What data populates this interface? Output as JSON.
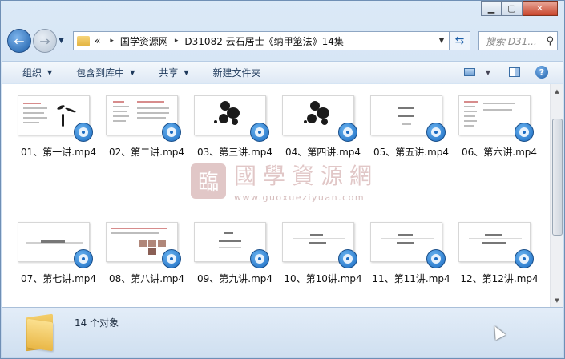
{
  "window": {
    "minimize_icon": "minimize-icon",
    "maximize_icon": "maximize-icon",
    "close_icon": "close-icon"
  },
  "nav": {
    "back_icon": "back-arrow-icon",
    "forward_icon": "forward-arrow-icon",
    "history_icon": "chevron-down-icon"
  },
  "address": {
    "overflow": "«",
    "crumbs": [
      "国学资源网",
      "D31082 云石居士《纳甲筮法》14集"
    ],
    "separator": "▸"
  },
  "search": {
    "placeholder": "搜索 D31...",
    "icon": "search-icon"
  },
  "toolbar": {
    "organize": "组织",
    "include_library": "包含到库中",
    "share": "共享",
    "new_folder": "新建文件夹"
  },
  "watermark": {
    "logo_char": "臨",
    "title": "國學資源網",
    "url": "www.guoxueziyuan.com"
  },
  "files": [
    {
      "name": "01、第一讲.mp4",
      "style": "ink-plant"
    },
    {
      "name": "02、第二讲.mp4",
      "style": "text-doc"
    },
    {
      "name": "03、第三讲.mp4",
      "style": "ink-blot"
    },
    {
      "name": "04、第四讲.mp4",
      "style": "ink-blot"
    },
    {
      "name": "05、第五讲.mp4",
      "style": "title-card"
    },
    {
      "name": "06、第六讲.mp4",
      "style": "text-doc"
    },
    {
      "name": "07、第七讲.mp4",
      "style": "title-line"
    },
    {
      "name": "08、第八讲.mp4",
      "style": "boxes"
    },
    {
      "name": "09、第九讲.mp4",
      "style": "title-card"
    },
    {
      "name": "10、第10讲.mp4",
      "style": "title-card"
    },
    {
      "name": "11、第11讲.mp4",
      "style": "title-card"
    },
    {
      "name": "12、第12讲.mp4",
      "style": "title-card"
    }
  ],
  "status": {
    "count_text": "14 个对象"
  }
}
